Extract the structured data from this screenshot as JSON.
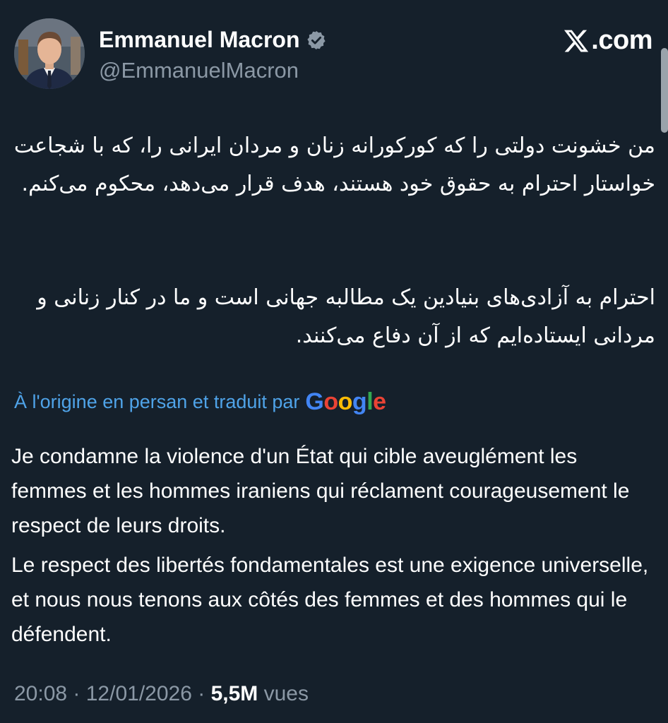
{
  "author": {
    "name": "Emmanuel Macron",
    "handle": "@EmmanuelMacron",
    "verified": true,
    "verified_color": "#8b98a5"
  },
  "brand": {
    "icon": "x-logo-icon",
    "suffix": ".com"
  },
  "original_text": {
    "language": "fa",
    "paragraphs": [
      "من خشونت دولتی را که کورکورانه زنان و مردان ایرانی را، که با شجاعت خواستار احترام به حقوق خود هستند، هدف قرار می‌دهد، محکوم می‌کنم.",
      "احترام به آزادی‌های بنیادین یک مطالبه جهانی است و ما در کنار زنانی و مردانی ایستاده‌ایم که از آن دفاع می‌کنند."
    ]
  },
  "translation": {
    "note": "À l'origine en persan et traduit par",
    "provider": "Google",
    "note_color": "#4fa3e8",
    "paragraphs": [
      "Je condamne la violence d'un État qui cible aveuglément les femmes et les hommes iraniens qui réclament courageusement le respect de leurs droits.",
      "Le respect des libertés fondamentales est une exigence universelle, et nous nous tenons aux côtés des femmes et des hommes qui le défendent."
    ]
  },
  "meta": {
    "time": "20:08",
    "separator": " · ",
    "date": "12/01/2026",
    "views_count": "5,5M",
    "views_label": " vues"
  },
  "colors": {
    "background": "#15202b",
    "text": "#ffffff",
    "muted": "#8b98a5"
  }
}
